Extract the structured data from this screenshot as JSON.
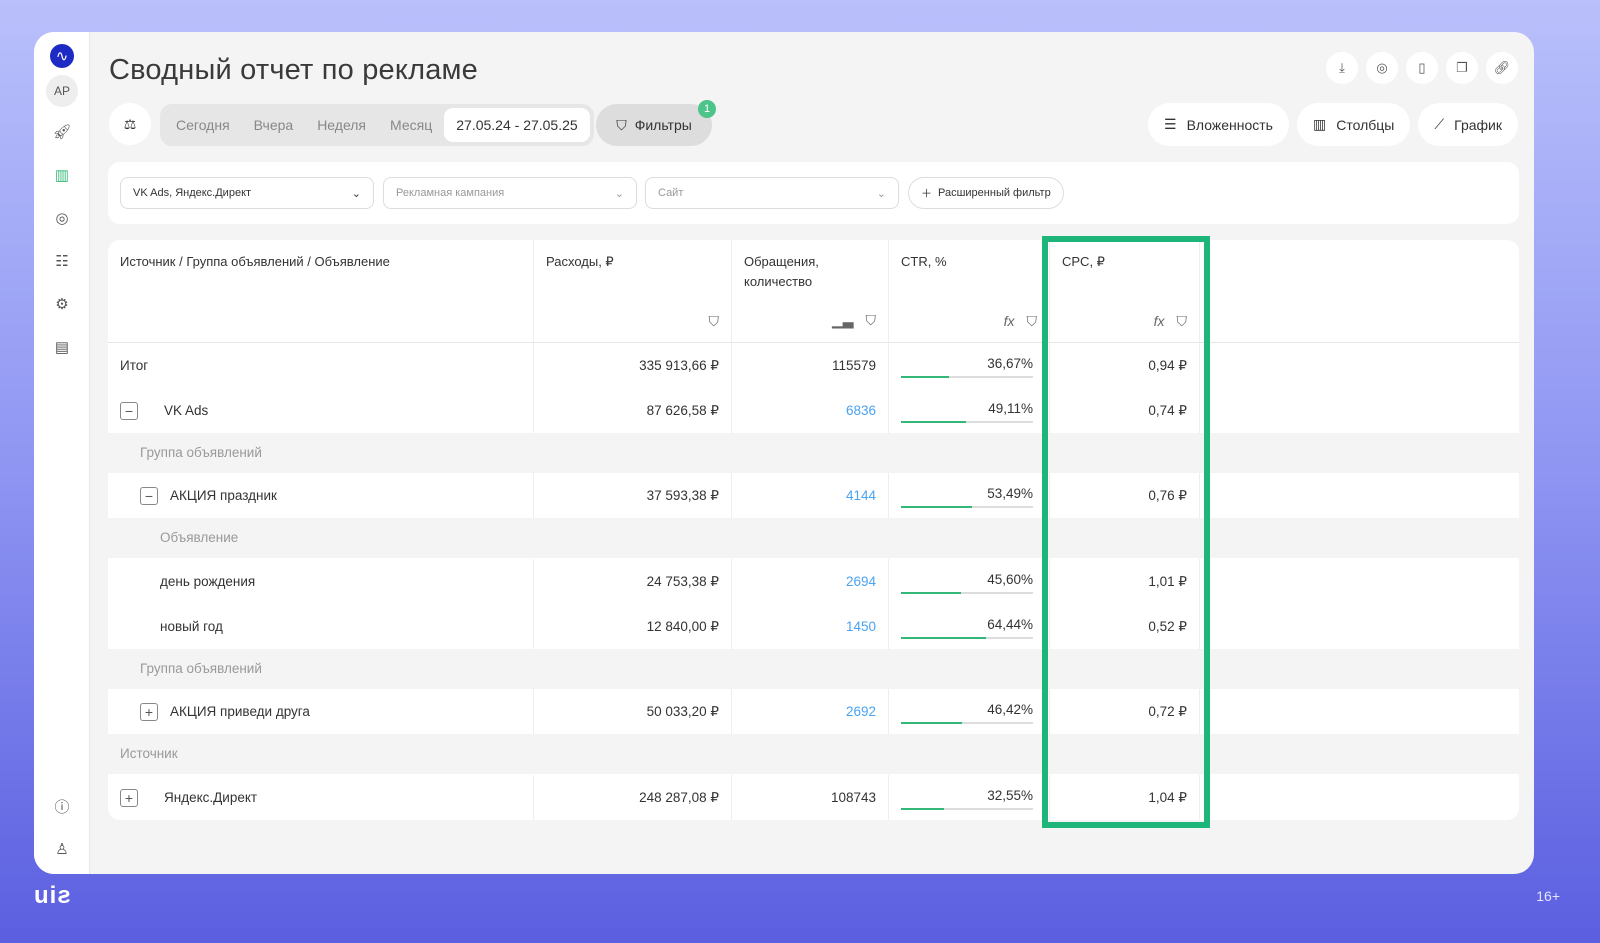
{
  "title": "Сводный отчет по рекламе",
  "sidebar": {
    "avatar": "АР"
  },
  "periods": [
    "Сегодня",
    "Вчера",
    "Неделя",
    "Месяц"
  ],
  "date_range": "27.05.24 - 27.05.25",
  "filters": {
    "label": "Фильтры",
    "count": "1"
  },
  "view_buttons": {
    "nesting": "Вложенность",
    "columns": "Столбцы",
    "chart": "График"
  },
  "filter_bar": {
    "source": "VK Ads, Яндекс.Директ",
    "campaign_placeholder": "Рекламная кампания",
    "site_placeholder": "Сайт",
    "advanced": "Расширенный фильтр"
  },
  "columns": [
    "Источник / Группа объявлений / Объявление",
    "Расходы, ₽",
    "Обращения, количество",
    "CTR, %",
    "CPC, ₽"
  ],
  "rows": [
    {
      "name": "Итог",
      "spend": "335 913,66 ₽",
      "leads": "115579",
      "ctr": "36,67%",
      "ctr_val": 36.67,
      "cpc": "0,94 ₽"
    },
    {
      "name": "VK Ads",
      "spend": "87 626,58 ₽",
      "leads": "6836",
      "ctr": "49,11%",
      "ctr_val": 49.11,
      "cpc": "0,74 ₽"
    },
    {
      "label": "Группа объявлений"
    },
    {
      "name": "АКЦИЯ праздник",
      "spend": "37 593,38 ₽",
      "leads": "4144",
      "ctr": "53,49%",
      "ctr_val": 53.49,
      "cpc": "0,76 ₽"
    },
    {
      "label": "Объявление"
    },
    {
      "name": "день рождения",
      "spend": "24 753,38 ₽",
      "leads": "2694",
      "ctr": "45,60%",
      "ctr_val": 45.6,
      "cpc": "1,01 ₽"
    },
    {
      "name": "новый год",
      "spend": "12 840,00 ₽",
      "leads": "1450",
      "ctr": "64,44%",
      "ctr_val": 64.44,
      "cpc": "0,52 ₽"
    },
    {
      "label": "Группа объявлений"
    },
    {
      "name": "АКЦИЯ приведи друга",
      "spend": "50 033,20 ₽",
      "leads": "2692",
      "ctr": "46,42%",
      "ctr_val": 46.42,
      "cpc": "0,72 ₽"
    },
    {
      "label": "Источник"
    },
    {
      "name": "Яндекс.Директ",
      "spend": "248 287,08 ₽",
      "leads": "108743",
      "ctr": "32,55%",
      "ctr_val": 32.55,
      "cpc": "1,04 ₽"
    }
  ],
  "footer": {
    "brand": "uis",
    "age": "16+"
  }
}
